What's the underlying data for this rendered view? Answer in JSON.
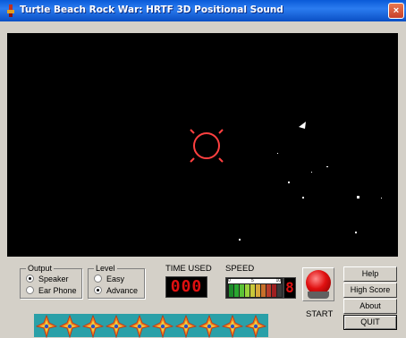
{
  "window": {
    "title": "Turtle Beach Rock War: HRTF 3D Positional Sound",
    "close_label": "×"
  },
  "output": {
    "label": "Output",
    "options": [
      {
        "label": "Speaker",
        "selected": true
      },
      {
        "label": "Ear Phone",
        "selected": false
      }
    ]
  },
  "level": {
    "label": "Level",
    "options": [
      {
        "label": "Easy",
        "selected": false
      },
      {
        "label": "Advance",
        "selected": true
      }
    ]
  },
  "time_used": {
    "label": "TIME USED",
    "value": "000"
  },
  "speed": {
    "label": "SPEED",
    "scale": [
      "0",
      "5",
      "10"
    ],
    "level_fraction": 0.85,
    "digit": "8"
  },
  "start": {
    "label": "START"
  },
  "buttons": {
    "help": "Help",
    "high_score": "High Score",
    "about": "About",
    "quit": "QUIT"
  },
  "lives": {
    "count": 10
  },
  "colors": {
    "title_bar": "#0a5ad8",
    "game_bg": "#000000",
    "lcd": "#e01010",
    "crosshair": "#ff4040",
    "lives_bar": "#2aa0a8"
  },
  "icons": {
    "title": "rock-icon",
    "crosshair": "crosshair-icon",
    "life": "ship-icon",
    "start": "red-button-icon"
  }
}
